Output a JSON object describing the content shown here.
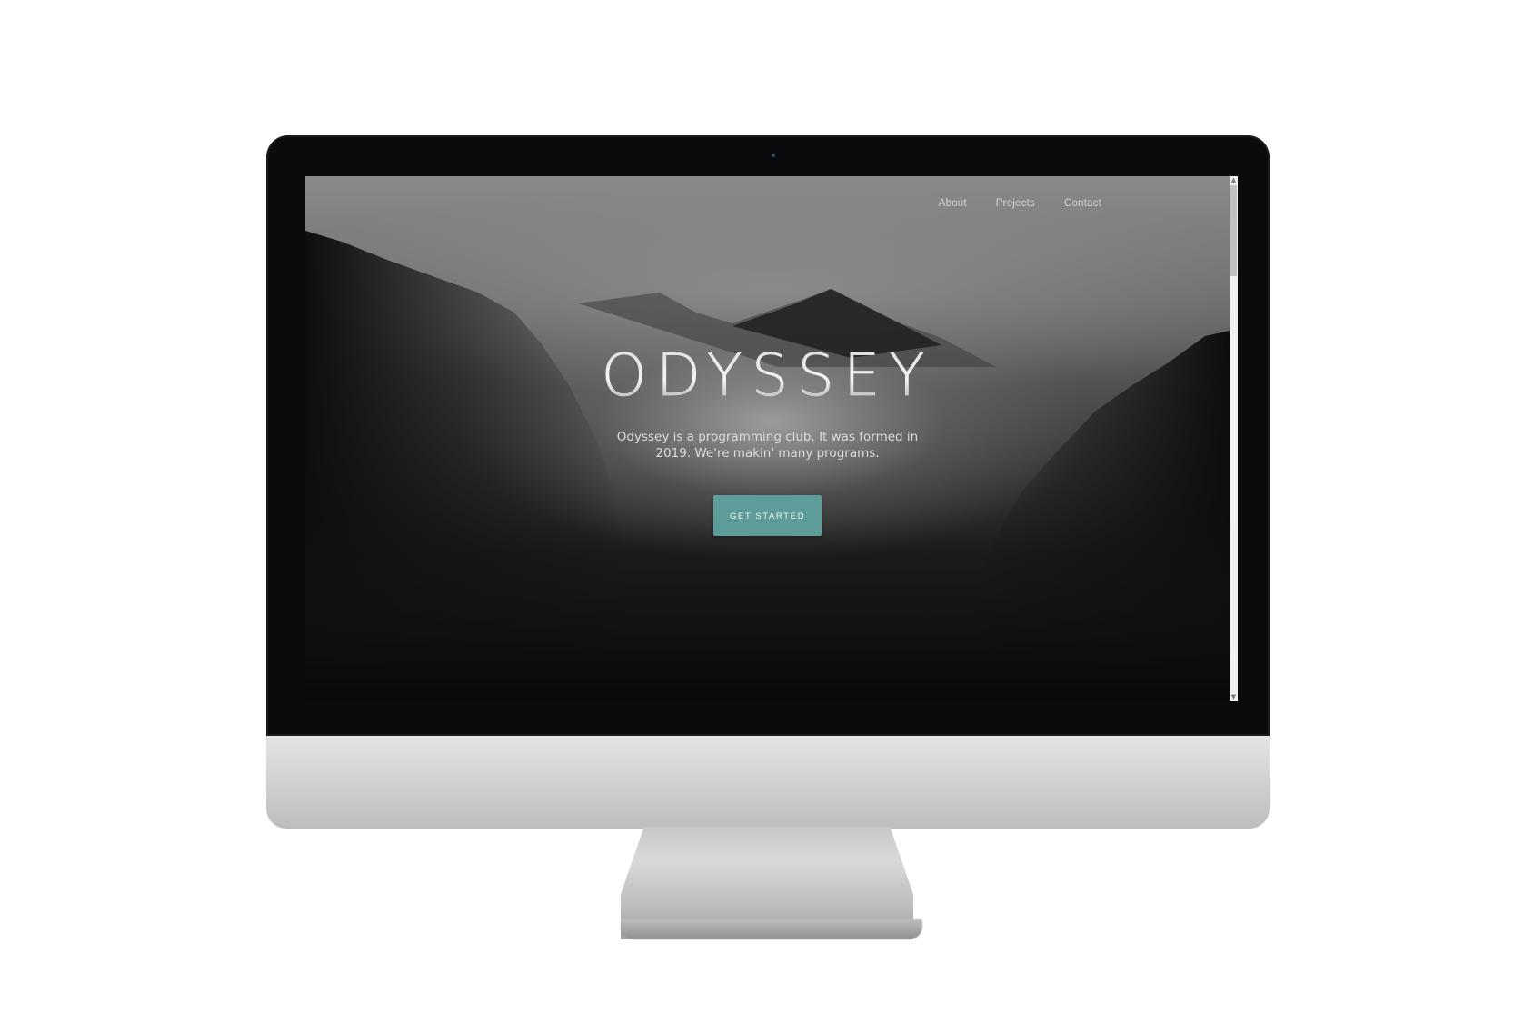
{
  "site": {
    "nav": [
      "About",
      "Projects",
      "Contact"
    ],
    "hero": {
      "title": "ODYSSEY",
      "description": "Odyssey is a programming club. It was formed in 2019. We're makin' many programs.",
      "cta_label": "GET STARTED"
    }
  },
  "scrollbar": {
    "up_icon": "▲",
    "down_icon": "▼"
  },
  "colors": {
    "accent": "#5d9c98",
    "background": "#0c0c0d",
    "text": "#dcdcdc"
  }
}
